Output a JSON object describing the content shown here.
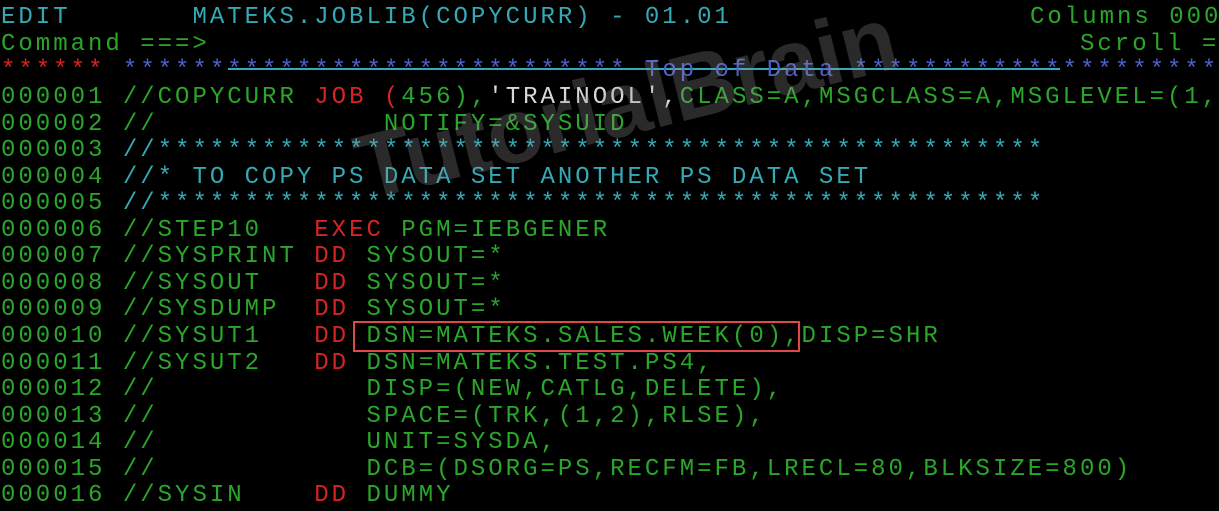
{
  "colors": {
    "green": "#2aa62a",
    "cyan": "#35a9b5",
    "red": "#d42424",
    "white": "#d8d8d8",
    "blue": "#4f5fcc",
    "highlight_box": "#e04848"
  },
  "header": {
    "mode": "EDIT",
    "dataset": "MATEKS.JOBLIB(COPYCURR) - 01.01",
    "columns_label": "Columns 000",
    "command_label": "Command ===>",
    "command_value": "",
    "scroll_label": "Scroll ="
  },
  "top_marker": {
    "red_stars": "******",
    "left_stars": "*****************************",
    "label": "Top of Data",
    "right_stars": "*********************"
  },
  "lines": [
    {
      "num": "000001",
      "segs": [
        {
          "t": "//COPYCURR ",
          "c": "g"
        },
        {
          "t": "JOB (",
          "c": "r"
        },
        {
          "t": "456),",
          "c": "g"
        },
        {
          "t": "'TRAINOOL',",
          "c": "w"
        },
        {
          "t": "CLASS=A,MSGCLASS=A,MSGLEVEL=(1,",
          "c": "g"
        }
      ]
    },
    {
      "num": "000002",
      "segs": [
        {
          "t": "//             NOTIFY=&SYSUID",
          "c": "g"
        }
      ]
    },
    {
      "num": "000003",
      "segs": [
        {
          "t": "//***************************************************",
          "c": "c"
        }
      ]
    },
    {
      "num": "000004",
      "segs": [
        {
          "t": "//* TO COPY PS DATA SET ANOTHER PS DATA SET",
          "c": "c"
        }
      ]
    },
    {
      "num": "000005",
      "segs": [
        {
          "t": "//***************************************************",
          "c": "c"
        }
      ]
    },
    {
      "num": "000006",
      "segs": [
        {
          "t": "//STEP10   ",
          "c": "g"
        },
        {
          "t": "EXEC",
          "c": "r"
        },
        {
          "t": " PGM=IEBGENER",
          "c": "g"
        }
      ]
    },
    {
      "num": "000007",
      "segs": [
        {
          "t": "//SYSPRINT ",
          "c": "g"
        },
        {
          "t": "DD",
          "c": "r"
        },
        {
          "t": " SYSOUT=*",
          "c": "g"
        }
      ]
    },
    {
      "num": "000008",
      "segs": [
        {
          "t": "//SYSOUT   ",
          "c": "g"
        },
        {
          "t": "DD",
          "c": "r"
        },
        {
          "t": " SYSOUT=*",
          "c": "g"
        }
      ]
    },
    {
      "num": "000009",
      "segs": [
        {
          "t": "//SYSDUMP  ",
          "c": "g"
        },
        {
          "t": "DD",
          "c": "r"
        },
        {
          "t": " SYSOUT=*",
          "c": "g"
        }
      ]
    },
    {
      "num": "000010",
      "segs": [
        {
          "t": "//SYSUT1   ",
          "c": "g"
        },
        {
          "t": "DD",
          "c": "r"
        },
        {
          "t": " DSN=MATEKS.SALES.WEEK(0),DISP=SHR",
          "c": "g"
        }
      ]
    },
    {
      "num": "000011",
      "segs": [
        {
          "t": "//SYSUT2   ",
          "c": "g"
        },
        {
          "t": "DD",
          "c": "r"
        },
        {
          "t": " DSN=MATEKS.TEST.PS4,",
          "c": "g"
        }
      ]
    },
    {
      "num": "000012",
      "segs": [
        {
          "t": "//            DISP=(NEW,CATLG,DELETE),",
          "c": "g"
        }
      ]
    },
    {
      "num": "000013",
      "segs": [
        {
          "t": "//            SPACE=(TRK,(1,2),RLSE),",
          "c": "g"
        }
      ]
    },
    {
      "num": "000014",
      "segs": [
        {
          "t": "//            UNIT=SYSDA,",
          "c": "g"
        }
      ]
    },
    {
      "num": "000015",
      "segs": [
        {
          "t": "//            DCB=(DSORG=PS,RECFM=FB,LRECL=80,BLKSIZE=800)",
          "c": "g"
        }
      ]
    },
    {
      "num": "000016",
      "segs": [
        {
          "t": "//SYSIN    ",
          "c": "g"
        },
        {
          "t": "DD",
          "c": "r"
        },
        {
          "t": " DUMMY",
          "c": "g"
        }
      ]
    }
  ],
  "watermark": "TutorialBrain"
}
